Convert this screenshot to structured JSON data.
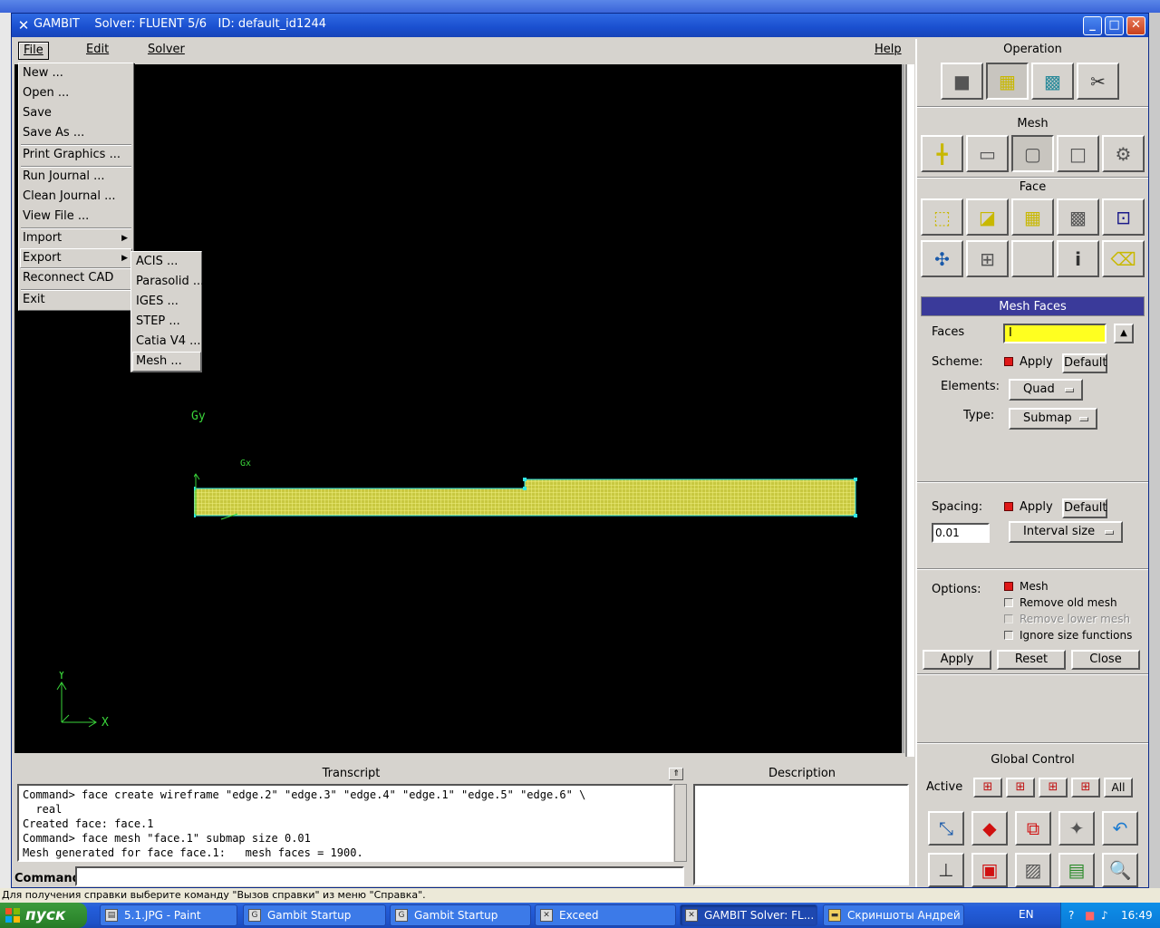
{
  "window": {
    "app_name": "GAMBIT",
    "solver": "Solver: FLUENT 5/6",
    "id": "ID: default_id1244"
  },
  "menubar": {
    "file": "File",
    "edit": "Edit",
    "solver": "Solver",
    "help": "Help"
  },
  "file_menu": {
    "items": [
      "New ...",
      "Open ...",
      "Save",
      "Save As ...",
      "Print Graphics ...",
      "Run Journal ...",
      "Clean Journal ...",
      "View File ...",
      "Import",
      "Export",
      "Reconnect CAD",
      "Exit"
    ]
  },
  "export_submenu": {
    "items": [
      "ACIS ...",
      "Parasolid ...",
      "IGES ...",
      "STEP ...",
      "Catia V4 ...",
      "Mesh ..."
    ]
  },
  "viewport": {
    "axis_x": "X",
    "axis_y": "Y",
    "gy_label": "Gy",
    "gx_label": "Gx"
  },
  "right_panel": {
    "operation": "Operation",
    "mesh": "Mesh",
    "face": "Face",
    "mesh_faces_title": "Mesh Faces",
    "faces_label": "Faces",
    "faces_value": "I",
    "scheme_label": "Scheme:",
    "apply": "Apply",
    "default": "Default",
    "elements_label": "Elements:",
    "elements_value": "Quad",
    "type_label": "Type:",
    "type_value": "Submap",
    "spacing_label": "Spacing:",
    "spacing_value": "0.01",
    "spacing_mode": "Interval size",
    "options_label": "Options:",
    "opt_mesh": "Mesh",
    "opt_remove_old": "Remove old mesh",
    "opt_remove_lower": "Remove lower mesh",
    "opt_ignore_size": "Ignore size functions",
    "btn_apply": "Apply",
    "btn_reset": "Reset",
    "btn_close": "Close",
    "global_control": "Global Control",
    "active_label": "Active",
    "all_label": "All"
  },
  "transcript": {
    "title": "Transcript",
    "text": "Command> face create wireframe \"edge.2\" \"edge.3\" \"edge.4\" \"edge.1\" \"edge.5\" \"edge.6\" \\\n  real\nCreated face: face.1\nCommand> face mesh \"face.1\" submap size 0.01\nMesh generated for face face.1:   mesh faces = 1900.",
    "command_label": "Command:"
  },
  "description": {
    "title": "Description"
  },
  "status_line": "Для получения справки выберите команду \"Вызов справки\" из меню \"Справка\".",
  "taskbar": {
    "start": "пуск",
    "tasks": [
      "5.1.JPG - Paint",
      "Gambit Startup",
      "Gambit Startup",
      "Exceed",
      "GAMBIT     Solver: FL...",
      "Скриншоты Андрей"
    ],
    "lang": "EN",
    "clock": "16:49"
  },
  "colors": {
    "mesh_fill": "#e8e860",
    "mesh_edge": "#30e8e8",
    "axis_green": "#3ad43a",
    "panel_header": "#3a3a9a",
    "faces_input": "#ffff20"
  }
}
